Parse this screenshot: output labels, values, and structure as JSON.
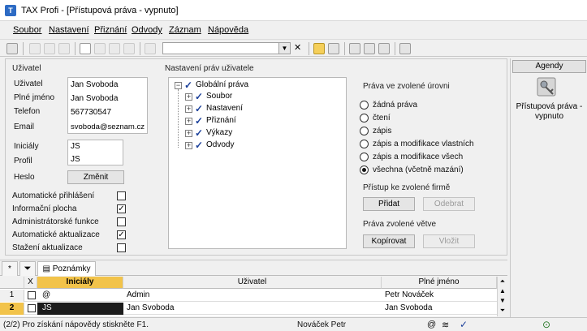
{
  "window": {
    "title": "TAX Profi - [Přístupová práva - vypnuto]"
  },
  "menu": [
    "Soubor",
    "Nastavení",
    "Přiznání",
    "Odvody",
    "Záznam",
    "Nápověda"
  ],
  "user": {
    "section_title": "Uživatel",
    "labels": {
      "user": "Uživatel",
      "full_name": "Plné jméno",
      "phone": "Telefon",
      "email": "Email",
      "initials": "Iniciály",
      "profile": "Profil",
      "password": "Heslo"
    },
    "values": {
      "user": "Jan Svoboda",
      "full_name": "Jan Svoboda",
      "phone": "567730547",
      "email": "svoboda@seznam.cz",
      "initials": "JS",
      "profile": "JS"
    },
    "change_button": "Změnit"
  },
  "options": [
    {
      "label": "Automatické přihlášení",
      "checked": false
    },
    {
      "label": "Informační plocha",
      "checked": true
    },
    {
      "label": "Administrátorské funkce",
      "checked": false
    },
    {
      "label": "Automatické aktualizace",
      "checked": true
    },
    {
      "label": "Stažení aktualizace",
      "checked": false
    }
  ],
  "rights": {
    "section_title": "Nastavení práv uživatele",
    "root": "Globální práva",
    "children": [
      "Soubor",
      "Nastavení",
      "Přiznání",
      "Výkazy",
      "Odvody"
    ]
  },
  "level": {
    "title": "Práva ve zvolené úrovni",
    "options": [
      "žádná práva",
      "čtení",
      "zápis",
      "zápis a modifikace vlastních",
      "zápis a modifikace všech",
      "všechna (včetně mazání)"
    ],
    "selected": 5
  },
  "firm_access": {
    "title": "Přístup ke zvolené firmě",
    "add": "Přidat",
    "remove": "Odebrat"
  },
  "branch": {
    "title": "Práva zvolené větve",
    "copy": "Kopírovat",
    "paste": "Vložit"
  },
  "agendy": {
    "header": "Agendy",
    "item": "Přístupová práva - vypnuto"
  },
  "tabs": {
    "star": "*",
    "notes": "Poznámky"
  },
  "grid": {
    "columns": {
      "x": "X",
      "initials": "Iniciály",
      "user": "Uživatel",
      "full_name": "Plné jméno"
    },
    "rows": [
      {
        "num": "1",
        "initials": "@",
        "user": "Admin",
        "full_name": "Petr Nováček"
      },
      {
        "num": "2",
        "initials": "JS",
        "user": "Jan Svoboda",
        "full_name": "Jan Svoboda"
      }
    ]
  },
  "status": {
    "left": "(2/2)  Pro získání nápovědy stiskněte F1.",
    "user": "Nováček Petr"
  }
}
